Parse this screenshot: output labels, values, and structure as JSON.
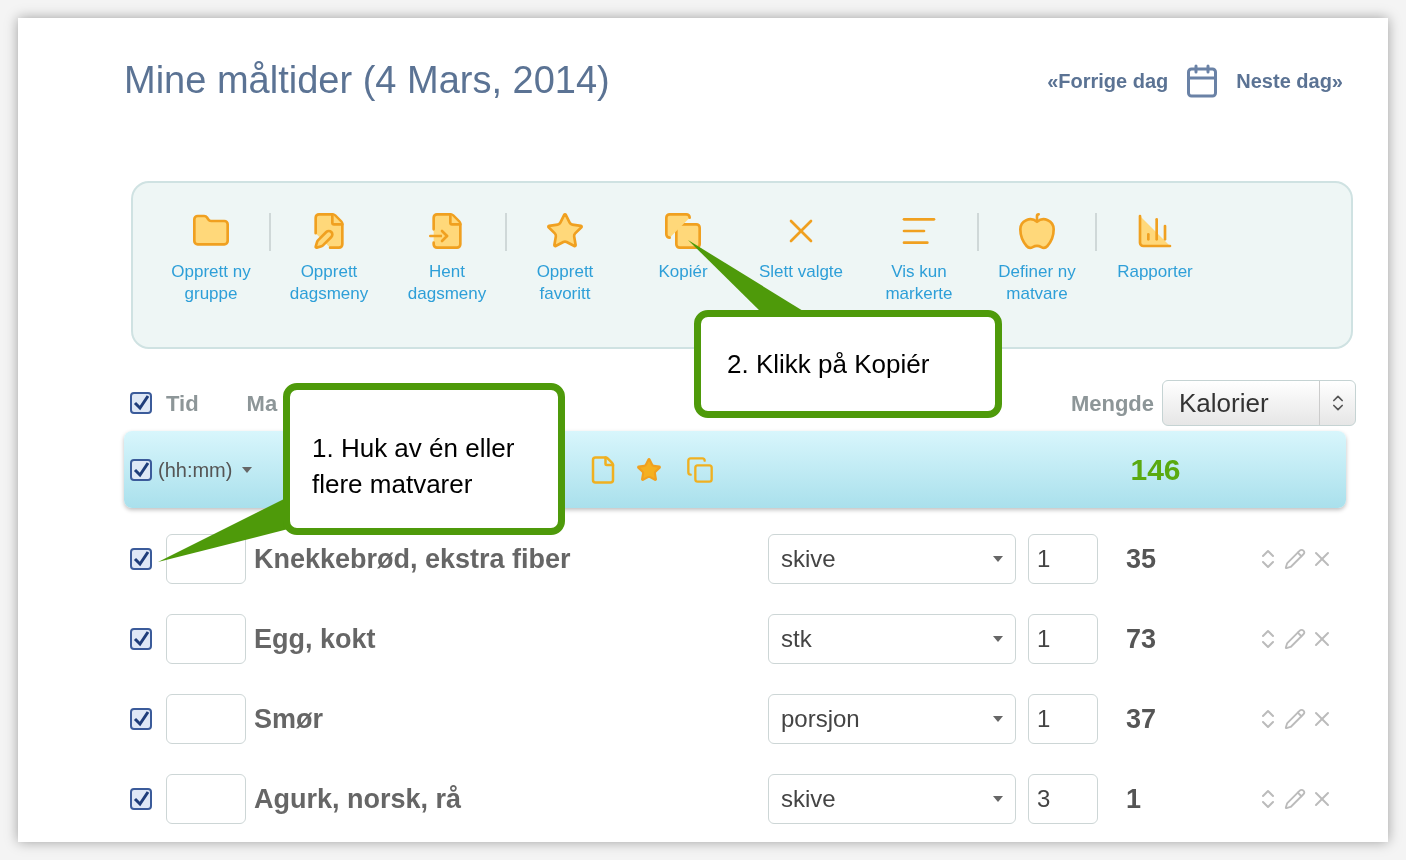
{
  "title": "Mine måltider (4 Mars, 2014)",
  "date_nav": {
    "previous": "«Forrige dag",
    "next": "Neste dag»"
  },
  "toolbar": [
    {
      "label": "Opprett ny gruppe",
      "separator_after": true
    },
    {
      "label": "Opprett dagsmeny",
      "separator_after": false
    },
    {
      "label": "Hent dagsmeny",
      "separator_after": true
    },
    {
      "label": "Opprett favoritt",
      "separator_after": false
    },
    {
      "label": "Kopiér",
      "separator_after": false
    },
    {
      "label": "Slett valgte",
      "separator_after": false
    },
    {
      "label": "Vis kun markerte",
      "separator_after": true
    },
    {
      "label": "Definer ny matvare",
      "separator_after": true
    },
    {
      "label": "Rapporter",
      "separator_after": false
    }
  ],
  "header": {
    "checked": true,
    "column_1": "Tid",
    "column_2": "Ma",
    "amount_label": "Mengde",
    "measure_select": "Kalorier"
  },
  "group": {
    "checked": true,
    "time_placeholder": "(hh:mm)",
    "total": "146"
  },
  "rows": [
    {
      "checked": true,
      "name": "Knekkebrød, ekstra fiber",
      "unit": "skive",
      "quantity": "1",
      "calories": "35"
    },
    {
      "checked": true,
      "name": "Egg, kokt",
      "unit": "stk",
      "quantity": "1",
      "calories": "73"
    },
    {
      "checked": true,
      "name": "Smør",
      "unit": "porsjon",
      "quantity": "1",
      "calories": "37"
    },
    {
      "checked": true,
      "name": "Agurk, norsk, rå",
      "unit": "skive",
      "quantity": "3",
      "calories": "1"
    }
  ],
  "callouts": [
    {
      "text": "1. Huk av én eller flere matvarer"
    },
    {
      "text": "2. Klikk på Kopiér"
    }
  ]
}
